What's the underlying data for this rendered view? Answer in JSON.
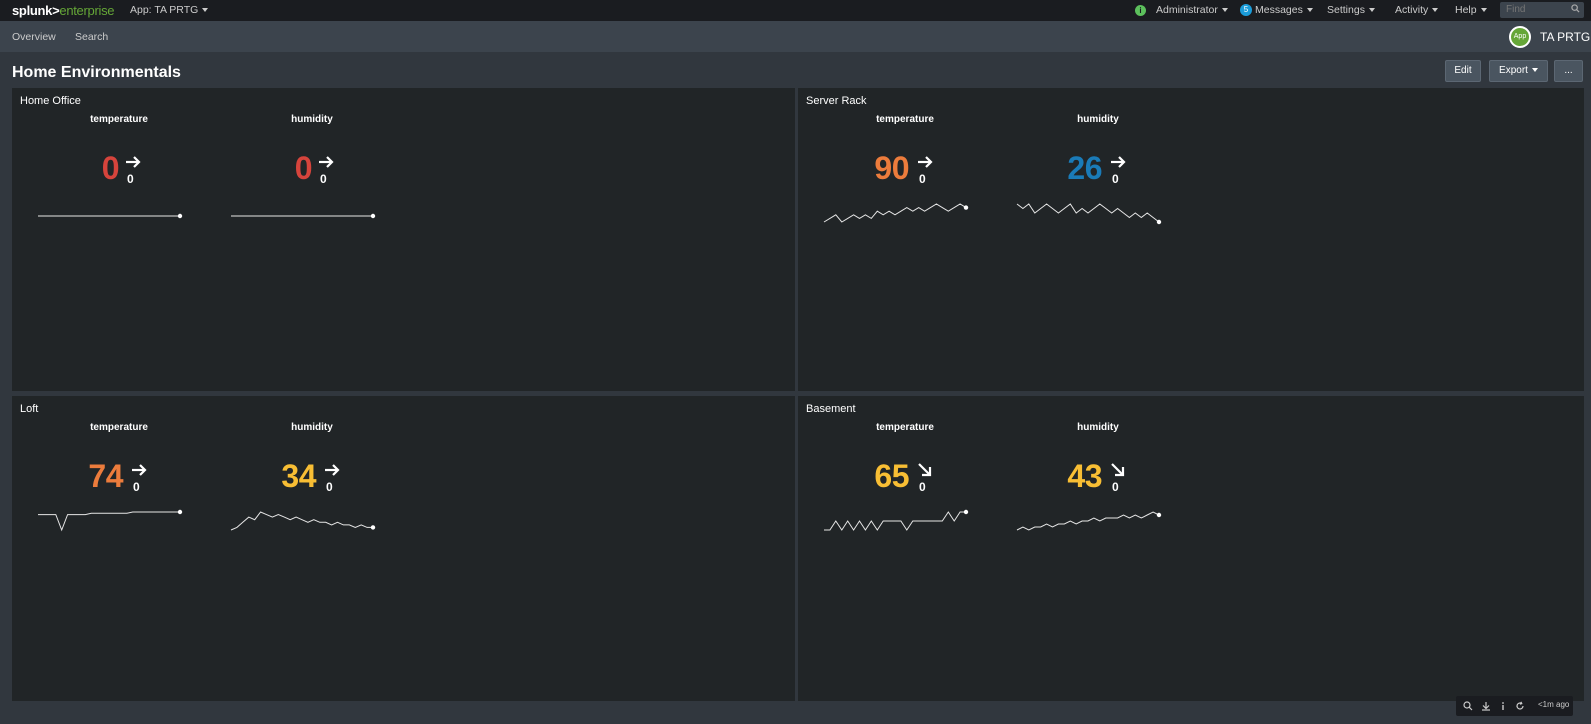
{
  "topbar": {
    "logo_a": "splunk>",
    "logo_b": "enterprise",
    "app_menu": "App: TA PRTG",
    "admin": "Administrator",
    "messages_count": "5",
    "messages": "Messages",
    "settings": "Settings",
    "activity": "Activity",
    "help": "Help",
    "find_placeholder": "Find",
    "info_icon": "info-icon"
  },
  "appbar": {
    "overview": "Overview",
    "search": "Search",
    "app_icon_label": "App",
    "app_name": "TA PRTG"
  },
  "dashboard": {
    "title": "Home Environmentals",
    "edit_label": "Edit",
    "export_label": "Export",
    "more_label": "..."
  },
  "panels": [
    {
      "title": "Home Office",
      "metrics": [
        {
          "label": "temperature",
          "value": "0",
          "delta": "0",
          "trend": "right",
          "color": "#d6443c",
          "spark": [
            0,
            0,
            0,
            0,
            0,
            0,
            0,
            0,
            0,
            0,
            0,
            0,
            0,
            0,
            0,
            0,
            0,
            0,
            0,
            0
          ]
        },
        {
          "label": "humidity",
          "value": "0",
          "delta": "0",
          "trend": "right",
          "color": "#d6443c",
          "spark": [
            0,
            0,
            0,
            0,
            0,
            0,
            0,
            0,
            0,
            0,
            0,
            0,
            0,
            0,
            0,
            0,
            0,
            0,
            0,
            0
          ]
        }
      ]
    },
    {
      "title": "Server Rack",
      "metrics": [
        {
          "label": "temperature",
          "value": "90",
          "delta": "0",
          "trend": "right",
          "color": "#ec7c3c",
          "spark": [
            86,
            87,
            88,
            86,
            87,
            88,
            87,
            88,
            87,
            89,
            88,
            89,
            88,
            89,
            90,
            89,
            90,
            89,
            90,
            91,
            90,
            89,
            90,
            91,
            90
          ]
        },
        {
          "label": "humidity",
          "value": "26",
          "delta": "0",
          "trend": "right",
          "color": "#1a7bb8",
          "spark": [
            30,
            29,
            30,
            28,
            29,
            30,
            29,
            28,
            29,
            30,
            28,
            29,
            28,
            29,
            30,
            29,
            28,
            29,
            28,
            27,
            28,
            27,
            28,
            27,
            26
          ]
        }
      ]
    },
    {
      "title": "Loft",
      "metrics": [
        {
          "label": "temperature",
          "value": "74",
          "delta": "0",
          "trend": "right",
          "color": "#ec7c3c",
          "spark": [
            72,
            72,
            72,
            72,
            60,
            72,
            72,
            72,
            72,
            73,
            73,
            73,
            73,
            73,
            73,
            73,
            74,
            74,
            74,
            74,
            74,
            74,
            74,
            74,
            74
          ]
        },
        {
          "label": "humidity",
          "value": "34",
          "delta": "0",
          "trend": "right",
          "color": "#f8be34",
          "spark": [
            33,
            34,
            36,
            38,
            37,
            40,
            39,
            38,
            39,
            38,
            37,
            38,
            37,
            36,
            37,
            36,
            36,
            35,
            36,
            35,
            35,
            34,
            35,
            34,
            34
          ]
        }
      ]
    },
    {
      "title": "Basement",
      "metrics": [
        {
          "label": "temperature",
          "value": "65",
          "delta": "0",
          "trend": "down-right",
          "color": "#f8be34",
          "spark": [
            63,
            63,
            64,
            63,
            64,
            63,
            64,
            63,
            64,
            63,
            64,
            64,
            64,
            64,
            63,
            64,
            64,
            64,
            64,
            64,
            64,
            65,
            64,
            65,
            65
          ]
        },
        {
          "label": "humidity",
          "value": "43",
          "delta": "0",
          "trend": "down-right",
          "color": "#f8be34",
          "spark": [
            38,
            39,
            38,
            39,
            39,
            40,
            39,
            40,
            40,
            41,
            40,
            41,
            41,
            42,
            41,
            42,
            42,
            42,
            43,
            42,
            43,
            42,
            43,
            44,
            43
          ]
        }
      ]
    }
  ],
  "footer": {
    "refresh_time": "<1m ago"
  }
}
